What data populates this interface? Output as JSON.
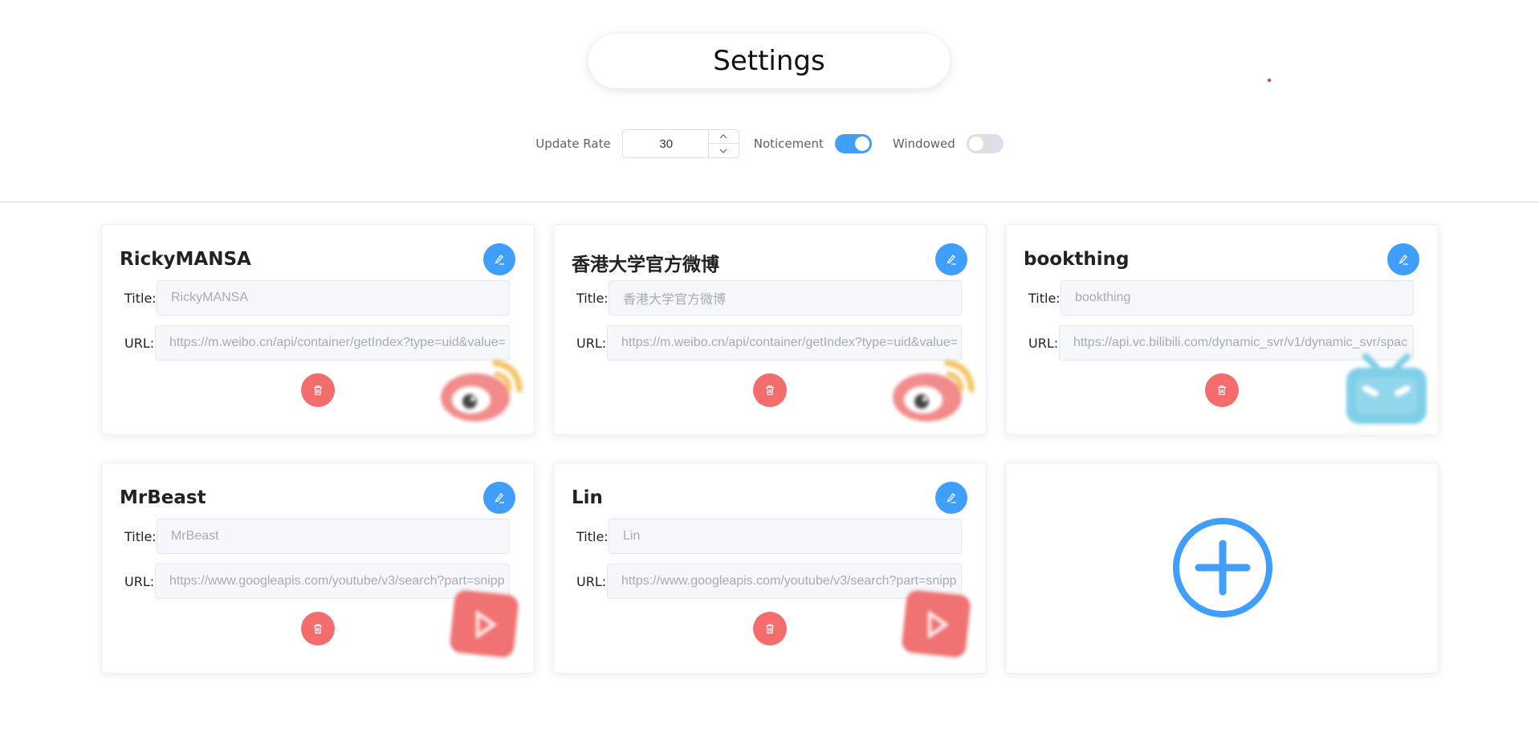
{
  "header": {
    "title": "Settings"
  },
  "controls": {
    "update_rate_label": "Update Rate",
    "update_rate_value": "30",
    "noticement_label": "Noticement",
    "noticement_on": true,
    "windowed_label": "Windowed",
    "windowed_on": false
  },
  "fields": {
    "title_label": "Title:",
    "url_label": "URL:"
  },
  "cards": [
    {
      "name": "RickyMANSA",
      "title_value": "RickyMANSA",
      "url_value": "https://m.weibo.cn/api/container/getIndex?type=uid&value=",
      "platform": "weibo-logo"
    },
    {
      "name": "香港大学官方微博",
      "title_value": "香港大学官方微博",
      "url_value": "https://m.weibo.cn/api/container/getIndex?type=uid&value=",
      "platform": "weibo-logo"
    },
    {
      "name": "bookthing",
      "title_value": "bookthing",
      "url_value": "https://api.vc.bilibili.com/dynamic_svr/v1/dynamic_svr/spac",
      "platform": "bilibili-logo"
    },
    {
      "name": "MrBeast",
      "title_value": "MrBeast",
      "url_value": "https://www.googleapis.com/youtube/v3/search?part=snipp",
      "platform": "youtube-logo"
    },
    {
      "name": "Lin",
      "title_value": "Lin",
      "url_value": "https://www.googleapis.com/youtube/v3/search?part=snipp",
      "platform": "youtube-logo"
    }
  ],
  "colors": {
    "primary": "#409eff",
    "danger": "#f56c6c",
    "switch_off": "#dcdfe6"
  }
}
